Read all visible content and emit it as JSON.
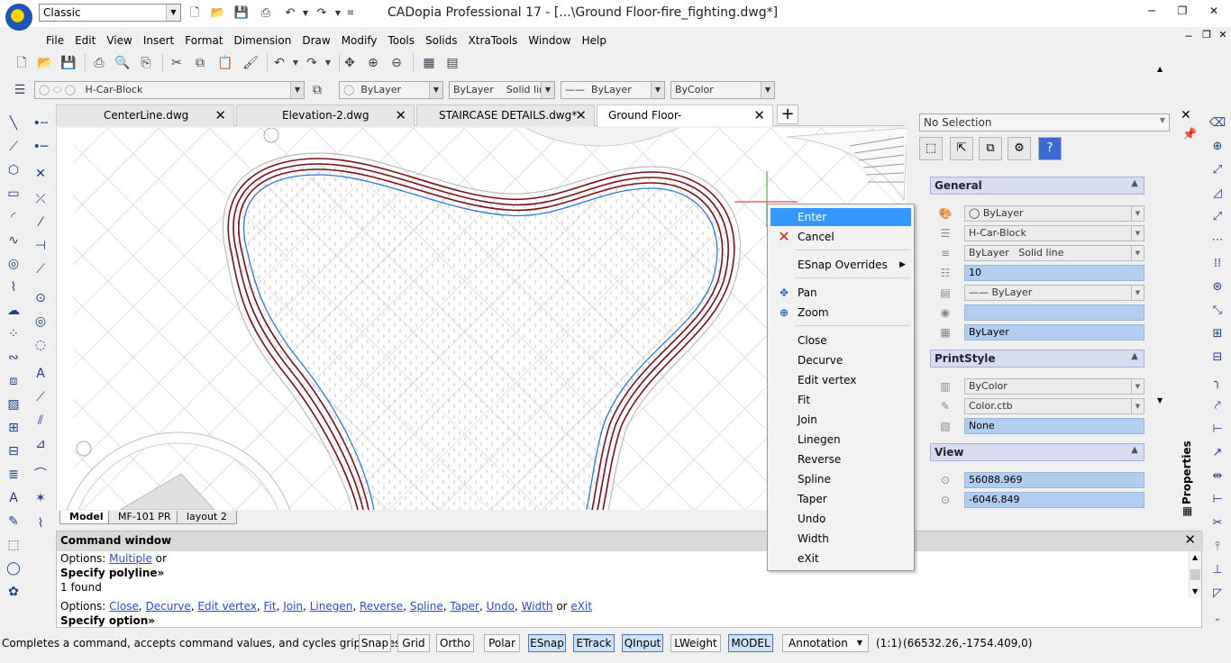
{
  "titlebar": {
    "workspace": "Classic",
    "title": "CADopia Professional 17 - [...\\Ground Floor-fire_fighting.dwg*]"
  },
  "menus": [
    "File",
    "Edit",
    "View",
    "Insert",
    "Format",
    "Dimension",
    "Draw",
    "Modify",
    "Tools",
    "Solids",
    "XtraTools",
    "Window",
    "Help"
  ],
  "propbar": {
    "layer": "H-Car-Block",
    "color": "ByLayer",
    "linetype": "ByLayer",
    "linetype_desc": "Solid line",
    "lineweight": "ByLayer",
    "plotstyle": "ByColor"
  },
  "doc_tabs": [
    "CenterLine.dwg",
    "Elevation-2.dwg",
    "STAIRCASE DETAILS.dwg*",
    "Ground Floor-fire_fighting.dwg*"
  ],
  "layout_tabs": [
    "Model",
    "MF-101 PR",
    "layout 2"
  ],
  "context_menu": {
    "items": [
      "Enter",
      "Cancel",
      "ESnap Overrides",
      "Pan",
      "Zoom",
      "Close",
      "Decurve",
      "Edit vertex",
      "Fit",
      "Join",
      "Linegen",
      "Reverse",
      "Spline",
      "Taper",
      "Undo",
      "Width",
      "eXit"
    ],
    "selected": "Enter"
  },
  "properties": {
    "selection": "No Selection",
    "vertical_label": "Properties",
    "general_title": "General",
    "general": {
      "color": "ByLayer",
      "layer": "H-Car-Block",
      "linetype": "ByLayer",
      "linetype_desc": "Solid line",
      "ltscale": "10",
      "lineweight": "ByLayer",
      "thickness": "",
      "plotstyle": "ByLayer"
    },
    "printstyle_title": "PrintStyle",
    "printstyle": {
      "style": "ByColor",
      "table": "Color.ctb",
      "attached": "None"
    },
    "view_title": "View",
    "view": {
      "center_x": "56088.969",
      "center_y": "-6046.849"
    }
  },
  "command": {
    "title": "Command window",
    "line1_prefix": "Options: ",
    "line1_opt": "Multiple",
    "line1_suffix": " or",
    "line2": "Specify polyline»",
    "line3": "1 found",
    "options_prefix": "Options: ",
    "options": [
      "Close",
      "Decurve",
      "Edit vertex",
      "Fit",
      "Join",
      "Linegen",
      "Reverse",
      "Spline",
      "Taper",
      "Undo",
      "Width"
    ],
    "options_or": " or ",
    "options_last": "eXit",
    "prompt": "Specify option»"
  },
  "status": {
    "message": "Completes a command, accepts command values, and cycles grip modes",
    "buttons": [
      "Snap",
      "Grid",
      "Ortho",
      "Polar",
      "ESnap",
      "ETrack",
      "QInput",
      "LWeight",
      "MODEL"
    ],
    "annotation": "Annotation",
    "scale": "(1:1)",
    "coords": "(66532.26,-1754.409,0)"
  },
  "colors": {
    "accent": "#3399ff",
    "highlight_field": "#b1cdef",
    "polyline": "#7a0f18",
    "selection_line": "#2b7bd6"
  }
}
